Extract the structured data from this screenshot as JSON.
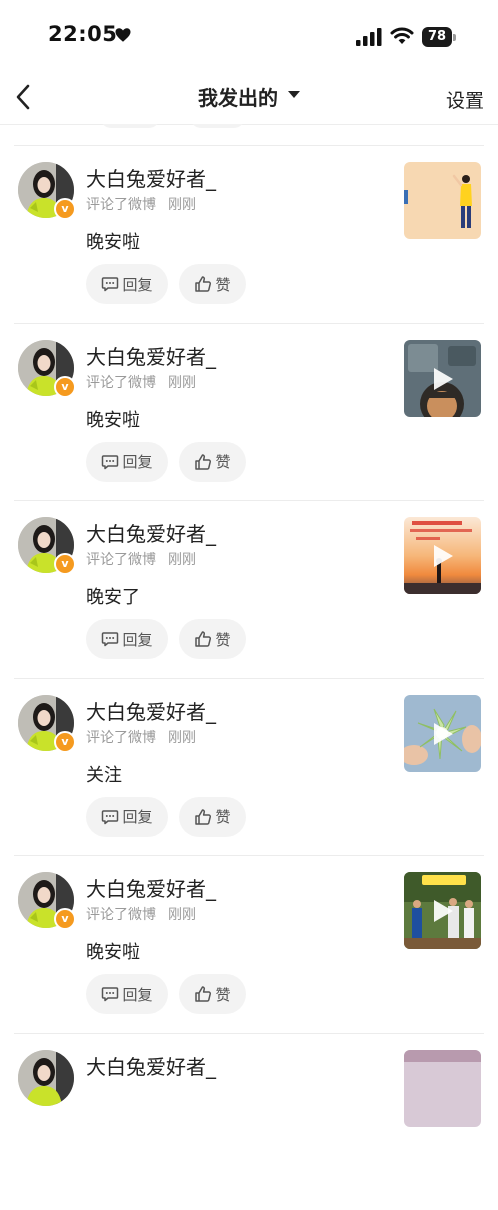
{
  "status": {
    "time": "22:05",
    "battery": "78"
  },
  "nav": {
    "title": "我发出的",
    "settings": "设置"
  },
  "colors": {
    "badge": "#f59a1f",
    "pill_bg": "#f3f3f3",
    "meta_text": "#9a9a9a"
  },
  "items": [
    {
      "username": "大白兔爱好者_",
      "action": "评论了微博",
      "time": "刚刚",
      "comment": "晚安啦",
      "reply_label": "回复",
      "like_label": "赞",
      "thumb_icon": "illustration-thumbnail"
    },
    {
      "username": "大白兔爱好者_",
      "action": "评论了微博",
      "time": "刚刚",
      "comment": "晚安啦",
      "reply_label": "回复",
      "like_label": "赞",
      "thumb_icon": "video-thumbnail"
    },
    {
      "username": "大白兔爱好者_",
      "action": "评论了微博",
      "time": "刚刚",
      "comment": "晚安了",
      "reply_label": "回复",
      "like_label": "赞",
      "thumb_icon": "video-thumbnail"
    },
    {
      "username": "大白兔爱好者_",
      "action": "评论了微博",
      "time": "刚刚",
      "comment": "关注",
      "reply_label": "回复",
      "like_label": "赞",
      "thumb_icon": "video-thumbnail"
    },
    {
      "username": "大白兔爱好者_",
      "action": "评论了微博",
      "time": "刚刚",
      "comment": "晚安啦",
      "reply_label": "回复",
      "like_label": "赞",
      "thumb_icon": "video-thumbnail"
    },
    {
      "username": "大白兔爱好者_"
    }
  ]
}
